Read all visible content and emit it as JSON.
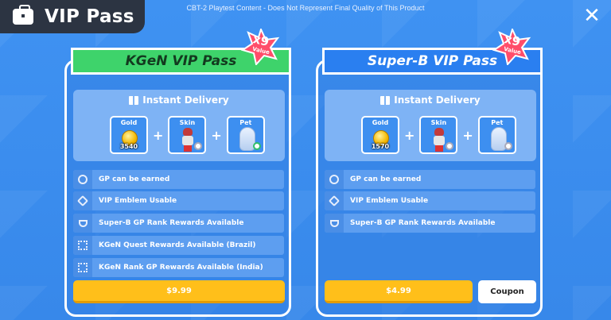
{
  "header": {
    "title": "VIP Pass"
  },
  "disclaimer": "CBT-2 Playtest Content - Does Not Represent Final Quality of This Product",
  "passes": [
    {
      "name": "KGeN VIP Pass",
      "badge": {
        "multiplier": "x9",
        "label": "Value"
      },
      "delivery_title": "Instant Delivery",
      "items": [
        {
          "label": "Gold",
          "amount": "3540",
          "icon": "gold-coin-icon"
        },
        {
          "label": "Skin",
          "icon": "skin-character-icon"
        },
        {
          "label": "Pet",
          "icon": "pet-icon"
        }
      ],
      "features": [
        {
          "text": "GP can be earned",
          "icon": "gp-icon"
        },
        {
          "text": "VIP Emblem Usable",
          "icon": "diamond-emblem-icon"
        },
        {
          "text": "Super-B GP Rank Rewards Available",
          "icon": "trophy-icon"
        },
        {
          "text": "KGeN Quest Rewards Available (Brazil)",
          "icon": "kgen-icon"
        },
        {
          "text": "KGeN Rank GP Rewards Available (India)",
          "icon": "kgen-icon"
        }
      ],
      "price": "$9.99"
    },
    {
      "name": "Super-B VIP Pass",
      "badge": {
        "multiplier": "x9",
        "label": "Value"
      },
      "delivery_title": "Instant Delivery",
      "items": [
        {
          "label": "Gold",
          "amount": "1570",
          "icon": "gold-coin-icon"
        },
        {
          "label": "Skin",
          "icon": "skin-character-icon"
        },
        {
          "label": "Pet",
          "icon": "pet-icon"
        }
      ],
      "features": [
        {
          "text": "GP can be earned",
          "icon": "gp-icon"
        },
        {
          "text": "VIP Emblem Usable",
          "icon": "diamond-emblem-icon"
        },
        {
          "text": "Super-B GP Rank Rewards Available",
          "icon": "trophy-icon"
        }
      ],
      "price": "$4.99",
      "coupon_label": "Coupon"
    }
  ],
  "colors": {
    "background": "#3d8ff0",
    "kgen_banner": "#3ed36b",
    "superb_banner": "#2a7ff0",
    "buy_button": "#ffbf1a",
    "badge": "#ff4d6a"
  }
}
